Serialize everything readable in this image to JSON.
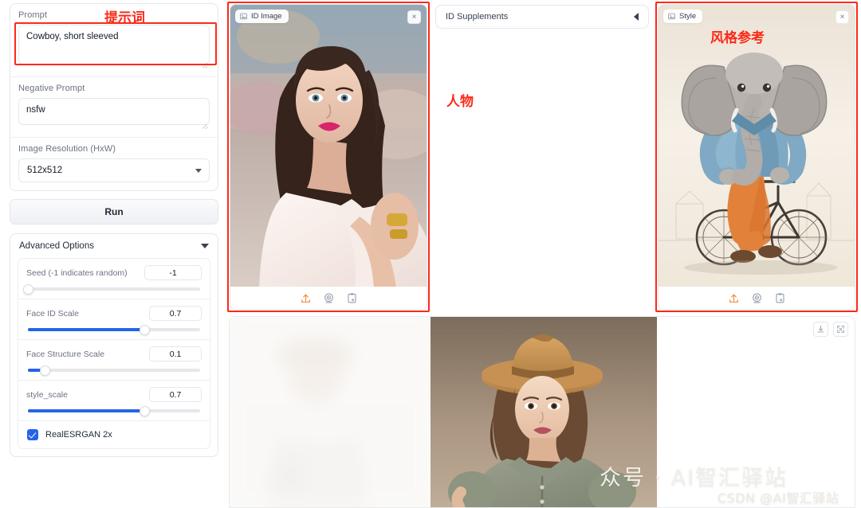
{
  "annotations": {
    "prompt_cn": "提示词",
    "person_cn": "人物",
    "style_cn": "风格参考",
    "accent_color": "#fb2a18"
  },
  "left_panel": {
    "prompt": {
      "label": "Prompt",
      "value": "Cowboy, short sleeved",
      "placeholder": "Prompt"
    },
    "negative_prompt": {
      "label": "Negative Prompt",
      "value": "nsfw",
      "placeholder": "Negative Prompt"
    },
    "resolution": {
      "label": "Image Resolution (HxW)",
      "value": "512x512",
      "options": [
        "512x512"
      ]
    },
    "run_button": "Run",
    "advanced": {
      "title": "Advanced Options",
      "sliders": [
        {
          "name": "Seed (-1 indicates random)",
          "value": "-1",
          "percent": 0
        },
        {
          "name": "Face ID Scale",
          "value": "0.7",
          "percent": 68
        },
        {
          "name": "Face Structure Scale",
          "value": "0.1",
          "percent": 10
        },
        {
          "name": "style_scale",
          "value": "0.7",
          "percent": 68
        }
      ],
      "checkbox": {
        "label": "RealESRGAN 2x",
        "checked": true
      }
    }
  },
  "id_image_panel": {
    "tag": "ID Image",
    "close": "×",
    "tools": [
      "upload-icon",
      "webcam-icon",
      "clipboard-icon"
    ]
  },
  "supplements_panel": {
    "title": "ID Supplements"
  },
  "style_panel": {
    "tag": "Style",
    "close": "×",
    "tools": [
      "upload-icon",
      "webcam-icon",
      "clipboard-icon"
    ]
  },
  "result_panel": {
    "tools": [
      "download-icon",
      "fullscreen-icon"
    ],
    "watermark_main": "众号 · AI智汇驿站",
    "watermark_sub": "CSDN @AI智汇驿站"
  },
  "colors": {
    "slider_blue": "#2563eb",
    "upload_orange": "#f08a3c",
    "border": "#e5e7eb"
  }
}
